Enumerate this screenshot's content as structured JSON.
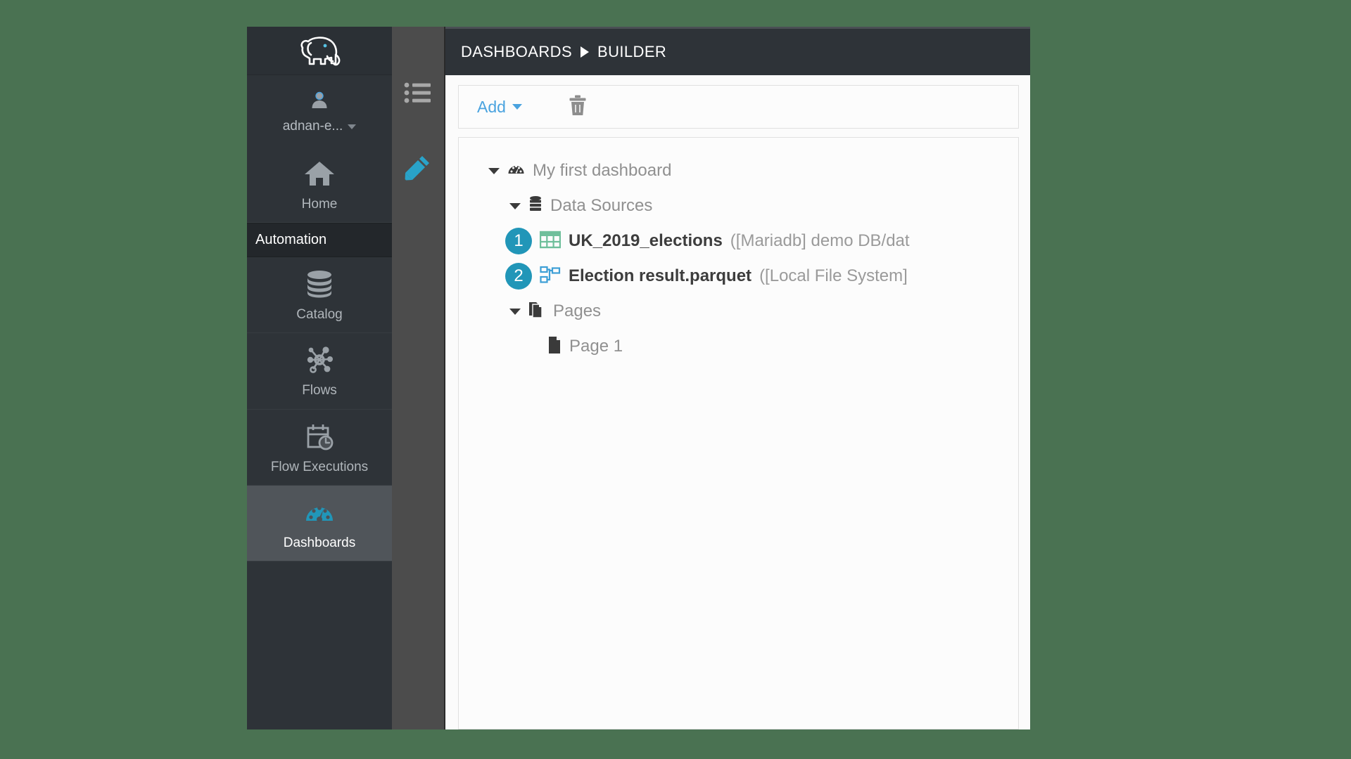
{
  "window": {
    "background_color": "#4a7252",
    "sidebar_color": "#2e3338",
    "accent_color": "#2196b8",
    "link_color": "#4aa3df"
  },
  "sidebar": {
    "logo_icon": "elephant-logo-icon",
    "user": {
      "avatar_icon": "user-avatar-icon",
      "name": "adnan-e...",
      "chevron_icon": "chevron-down-icon"
    },
    "items": [
      {
        "label": "Home",
        "icon": "home-icon",
        "active": false
      },
      {
        "label": "Catalog",
        "icon": "database-icon",
        "active": false
      },
      {
        "label": "Flows",
        "icon": "network-nodes-icon",
        "active": false
      },
      {
        "label": "Flow Executions",
        "icon": "calendar-clock-icon",
        "active": false
      },
      {
        "label": "Dashboards",
        "icon": "gauge-icon",
        "active": true
      }
    ],
    "section_label": "Automation"
  },
  "tool_rail": {
    "buttons": [
      {
        "name": "list-icon",
        "color": "#a8a8a8"
      },
      {
        "name": "pencil-icon",
        "color": "#29a3c9"
      }
    ]
  },
  "header": {
    "breadcrumb": {
      "root": "DASHBOARDS",
      "separator_icon": "triangle-right-icon",
      "current": "BUILDER"
    }
  },
  "toolbar": {
    "add_label": "Add",
    "add_chevron_icon": "chevron-down-icon",
    "delete_icon": "trash-icon"
  },
  "tree": {
    "root": {
      "label": "My first dashboard",
      "icon": "gauge-icon",
      "caret_icon": "caret-down-icon"
    },
    "data_sources": {
      "label": "Data Sources",
      "icon": "database-icon",
      "caret_icon": "caret-down-icon",
      "items": [
        {
          "badge": "1",
          "icon": "table-grid-icon",
          "name": "UK_2019_elections",
          "meta": "([Mariadb] demo DB/dat"
        },
        {
          "badge": "2",
          "icon": "sitemap-icon",
          "name": "Election result.parquet",
          "meta": "([Local File System]"
        }
      ]
    },
    "pages": {
      "label": "Pages",
      "icon": "copy-pages-icon",
      "caret_icon": "caret-down-icon",
      "items": [
        {
          "label": "Page 1",
          "icon": "document-icon"
        }
      ]
    }
  }
}
